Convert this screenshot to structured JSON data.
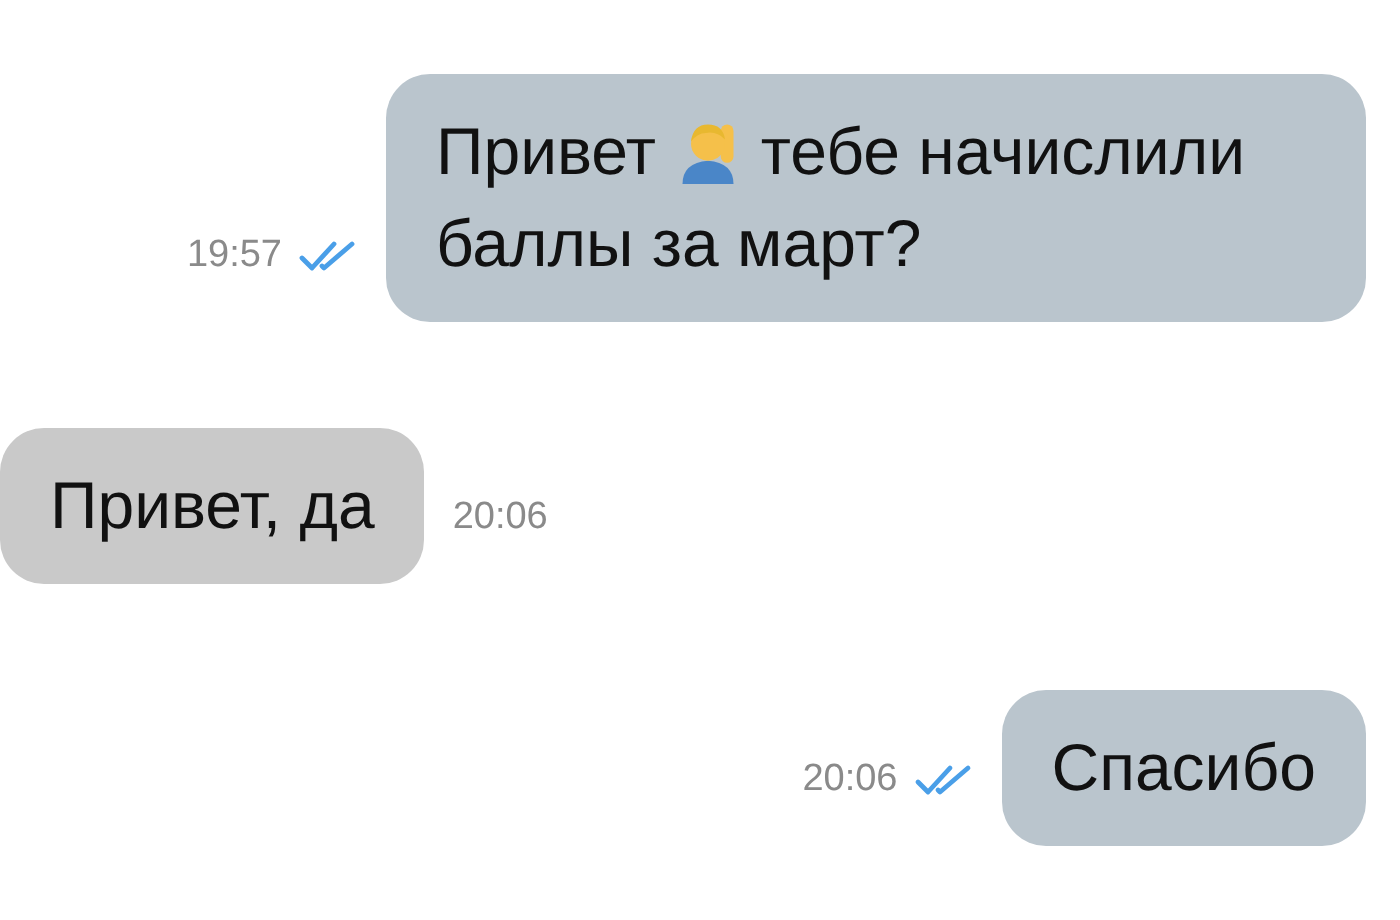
{
  "messages": [
    {
      "kind": "outgoing",
      "time": "19:57",
      "read": true,
      "parts": [
        {
          "kind": "text",
          "text": "Привет"
        },
        {
          "kind": "emoji"
        },
        {
          "kind": "text",
          "text": "тебе начислили"
        },
        {
          "kind": "text",
          "text": "баллы за март?"
        }
      ]
    },
    {
      "kind": "incoming",
      "time": "20:06",
      "parts": [
        {
          "kind": "text",
          "text": "Привет, да"
        }
      ]
    },
    {
      "kind": "outgoing",
      "time": "20:06",
      "read": true,
      "parts": [
        {
          "kind": "text",
          "text": "Спасибо"
        }
      ]
    }
  ]
}
